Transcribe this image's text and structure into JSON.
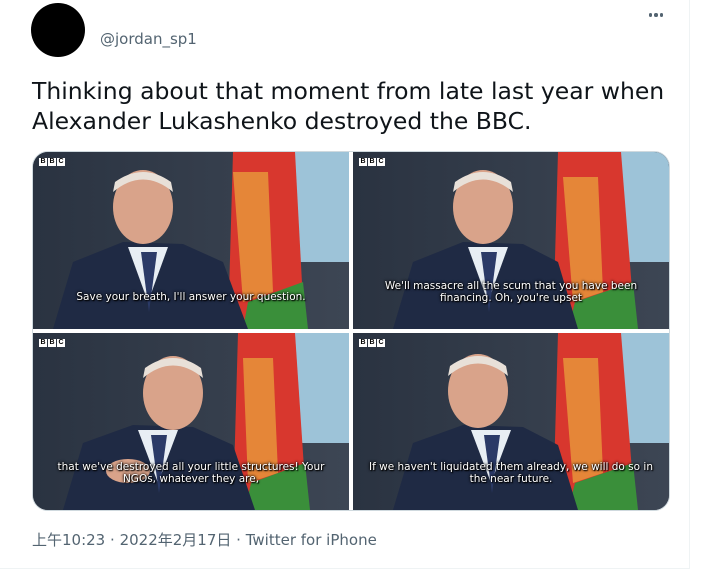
{
  "user": {
    "handle": "@jordan_sp1"
  },
  "menu": {
    "icon": "more-horizontal-icon"
  },
  "tweet": {
    "text": "Thinking about that moment from late last year when Alexander Lukashenko destroyed the BBC."
  },
  "media": {
    "watermark": "BBC",
    "frames": [
      {
        "subtitle": "Save your breath, I'll answer your question."
      },
      {
        "subtitle": "We'll massacre all the scum that you have been financing. Oh, you're upset"
      },
      {
        "subtitle": "that we've destroyed all your little structures! Your NGOs, whatever they are,"
      },
      {
        "subtitle": "If we haven't liquidated them already, we will do so in the near future."
      }
    ]
  },
  "meta": {
    "time": "上午10:23",
    "date": "2022年2月17日",
    "separator": "·",
    "source": "Twitter for iPhone"
  }
}
